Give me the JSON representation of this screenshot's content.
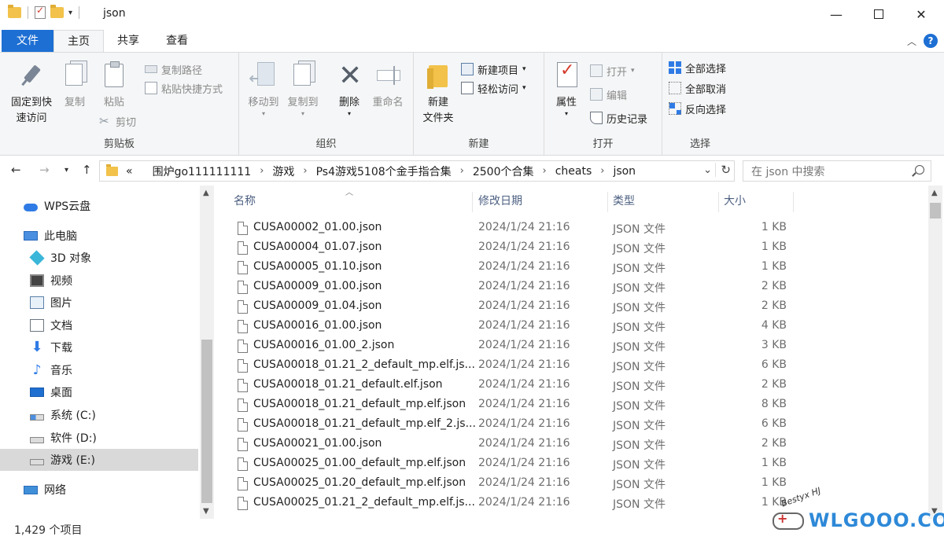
{
  "window": {
    "title": "json",
    "controls": {
      "minimize": "—",
      "close": "✕"
    }
  },
  "tabs": [
    {
      "label": "文件"
    },
    {
      "label": "主页"
    },
    {
      "label": "共享"
    },
    {
      "label": "查看"
    }
  ],
  "ribbon": {
    "clipboard": {
      "label": "剪贴板",
      "pin": "固定到快\n速访问",
      "copy": "复制",
      "paste": "粘贴",
      "copy_path": "复制路径",
      "paste_shortcut": "粘贴快捷方式",
      "cut": "剪切"
    },
    "organize": {
      "label": "组织",
      "move_to": "移动到",
      "copy_to": "复制到",
      "delete": "删除",
      "rename": "重命名"
    },
    "new": {
      "label": "新建",
      "new_folder": "新建\n文件夹",
      "new_item": "新建项目",
      "easy_access": "轻松访问"
    },
    "open": {
      "label": "打开",
      "properties": "属性",
      "open": "打开",
      "edit": "编辑",
      "history": "历史记录"
    },
    "select": {
      "label": "选择",
      "select_all": "全部选择",
      "select_none": "全部取消",
      "invert": "反向选择"
    }
  },
  "address": {
    "overflow": "«",
    "crumbs": [
      "围炉go111111111",
      "游戏",
      "Ps4游戏5108个金手指合集",
      "2500个合集",
      "cheats",
      "json"
    ],
    "separator": "›"
  },
  "search": {
    "placeholder": "在 json 中搜索"
  },
  "navpane": {
    "items": [
      {
        "label": "WPS云盘",
        "icon": "cloud-icon"
      },
      {
        "label": "此电脑",
        "icon": "computer-icon"
      },
      {
        "label": "3D 对象",
        "icon": "3d-objects-icon"
      },
      {
        "label": "视频",
        "icon": "video-icon"
      },
      {
        "label": "图片",
        "icon": "pictures-icon"
      },
      {
        "label": "文档",
        "icon": "documents-icon"
      },
      {
        "label": "下载",
        "icon": "download-icon"
      },
      {
        "label": "音乐",
        "icon": "music-icon"
      },
      {
        "label": "桌面",
        "icon": "desktop-icon"
      },
      {
        "label": "系统 (C:)",
        "icon": "system-drive-icon"
      },
      {
        "label": "软件 (D:)",
        "icon": "drive-icon"
      },
      {
        "label": "游戏 (E:)",
        "icon": "drive-icon",
        "selected": true
      },
      {
        "label": "网络",
        "icon": "network-icon"
      }
    ]
  },
  "columns": {
    "name": "名称",
    "date": "修改日期",
    "type": "类型",
    "size": "大小"
  },
  "files": [
    {
      "name": "CUSA00002_01.00.json",
      "date": "2024/1/24 21:16",
      "type": "JSON 文件",
      "size": "1 KB"
    },
    {
      "name": "CUSA00004_01.07.json",
      "date": "2024/1/24 21:16",
      "type": "JSON 文件",
      "size": "1 KB"
    },
    {
      "name": "CUSA00005_01.10.json",
      "date": "2024/1/24 21:16",
      "type": "JSON 文件",
      "size": "1 KB"
    },
    {
      "name": "CUSA00009_01.00.json",
      "date": "2024/1/24 21:16",
      "type": "JSON 文件",
      "size": "2 KB"
    },
    {
      "name": "CUSA00009_01.04.json",
      "date": "2024/1/24 21:16",
      "type": "JSON 文件",
      "size": "2 KB"
    },
    {
      "name": "CUSA00016_01.00.json",
      "date": "2024/1/24 21:16",
      "type": "JSON 文件",
      "size": "4 KB"
    },
    {
      "name": "CUSA00016_01.00_2.json",
      "date": "2024/1/24 21:16",
      "type": "JSON 文件",
      "size": "3 KB"
    },
    {
      "name": "CUSA00018_01.21_2_default_mp.elf.js...",
      "date": "2024/1/24 21:16",
      "type": "JSON 文件",
      "size": "6 KB"
    },
    {
      "name": "CUSA00018_01.21_default.elf.json",
      "date": "2024/1/24 21:16",
      "type": "JSON 文件",
      "size": "2 KB"
    },
    {
      "name": "CUSA00018_01.21_default_mp.elf.json",
      "date": "2024/1/24 21:16",
      "type": "JSON 文件",
      "size": "8 KB"
    },
    {
      "name": "CUSA00018_01.21_default_mp.elf_2.js...",
      "date": "2024/1/24 21:16",
      "type": "JSON 文件",
      "size": "6 KB"
    },
    {
      "name": "CUSA00021_01.00.json",
      "date": "2024/1/24 21:16",
      "type": "JSON 文件",
      "size": "2 KB"
    },
    {
      "name": "CUSA00025_01.00_default_mp.elf.json",
      "date": "2024/1/24 21:16",
      "type": "JSON 文件",
      "size": "1 KB"
    },
    {
      "name": "CUSA00025_01.20_default_mp.elf.json",
      "date": "2024/1/24 21:16",
      "type": "JSON 文件",
      "size": "1 KB"
    },
    {
      "name": "CUSA00025_01.21_2_default_mp.elf.js...",
      "date": "2024/1/24 21:16",
      "type": "JSON 文件",
      "size": "1 KB"
    }
  ],
  "status": {
    "count": "1,429 个项目"
  },
  "watermark": {
    "text": "WLGOOO.COM",
    "sig": "Bestyx HJ"
  }
}
